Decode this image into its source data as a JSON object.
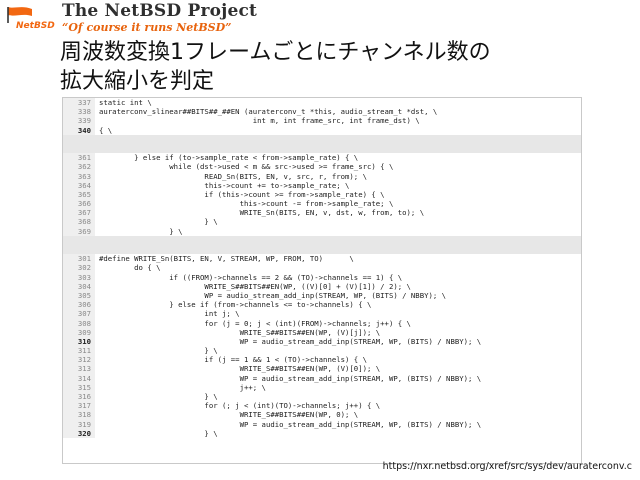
{
  "header": {
    "logo_text": "NetBSD",
    "project_title": "The NetBSD Project",
    "project_subtitle": "“Of course it runs NetBSD”"
  },
  "slide": {
    "title_line1": "周波数変換1フレームごとにチャンネル数の",
    "title_line2": "拡大縮小を判定"
  },
  "code": {
    "blocks": [
      {
        "lines": [
          {
            "n": "337",
            "t": "static int \\"
          },
          {
            "n": "338",
            "t": "auraterconv_slinear##BITS##_##EN (auraterconv_t *this, audio_stream_t *dst, \\"
          },
          {
            "n": "339",
            "t": "                                   int m, int frame_src, int frame_dst) \\"
          },
          {
            "n": "340",
            "t": "{ \\",
            "cur": true
          }
        ]
      },
      {
        "lines": [
          {
            "n": "361",
            "t": "        } else if (to->sample_rate < from->sample_rate) { \\"
          },
          {
            "n": "362",
            "t": "                while (dst->used < m && src->used >= frame_src) { \\"
          },
          {
            "n": "363",
            "t": "                        READ_Sn(BITS, EN, v, src, r, from); \\"
          },
          {
            "n": "364",
            "t": "                        this->count += to->sample_rate; \\"
          },
          {
            "n": "365",
            "t": "                        if (this->count >= from->sample_rate) { \\"
          },
          {
            "n": "366",
            "t": "                                this->count -= from->sample_rate; \\"
          },
          {
            "n": "367",
            "t": "                                WRITE_Sn(BITS, EN, v, dst, w, from, to); \\"
          },
          {
            "n": "368",
            "t": "                        } \\"
          },
          {
            "n": "369",
            "t": "                } \\"
          }
        ]
      },
      {
        "lines": [
          {
            "n": "301",
            "t": "#define WRITE_Sn(BITS, EN, V, STREAM, WP, FROM, TO)      \\"
          },
          {
            "n": "302",
            "t": "        do { \\"
          },
          {
            "n": "303",
            "t": "                if ((FROM)->channels == 2 && (TO)->channels == 1) { \\"
          },
          {
            "n": "304",
            "t": "                        WRITE_S##BITS##EN(WP, ((V)[0] + (V)[1]) / 2); \\"
          },
          {
            "n": "305",
            "t": "                        WP = audio_stream_add_inp(STREAM, WP, (BITS) / NBBY); \\"
          },
          {
            "n": "306",
            "t": "                } else if (from->channels <= to->channels) { \\"
          },
          {
            "n": "307",
            "t": "                        int j; \\"
          },
          {
            "n": "308",
            "t": "                        for (j = 0; j < (int)(FROM)->channels; j++) { \\"
          },
          {
            "n": "309",
            "t": "                                WRITE_S##BITS##EN(WP, (V)[j]); \\"
          },
          {
            "n": "310",
            "t": "                                WP = audio_stream_add_inp(STREAM, WP, (BITS) / NBBY); \\",
            "cur": true
          },
          {
            "n": "311",
            "t": "                        } \\"
          },
          {
            "n": "312",
            "t": "                        if (j == 1 && 1 < (TO)->channels) { \\"
          },
          {
            "n": "313",
            "t": "                                WRITE_S##BITS##EN(WP, (V)[0]); \\"
          },
          {
            "n": "314",
            "t": "                                WP = audio_stream_add_inp(STREAM, WP, (BITS) / NBBY); \\"
          },
          {
            "n": "315",
            "t": "                                j++; \\"
          },
          {
            "n": "316",
            "t": "                        } \\"
          },
          {
            "n": "317",
            "t": "                        for (; j < (int)(TO)->channels; j++) { \\"
          },
          {
            "n": "318",
            "t": "                                WRITE_S##BITS##EN(WP, 0); \\"
          },
          {
            "n": "319",
            "t": "                                WP = audio_stream_add_inp(STREAM, WP, (BITS) / NBBY); \\"
          },
          {
            "n": "320",
            "t": "                        } \\",
            "cur": true
          }
        ]
      }
    ]
  },
  "footer": {
    "url": "https://nxr.netbsd.org/xref/src/sys/dev/auraterconv.c"
  },
  "colors": {
    "brand_orange": "#e8630d",
    "line_number_bg": "#efefef",
    "gap_bg": "#e7e7e7"
  }
}
